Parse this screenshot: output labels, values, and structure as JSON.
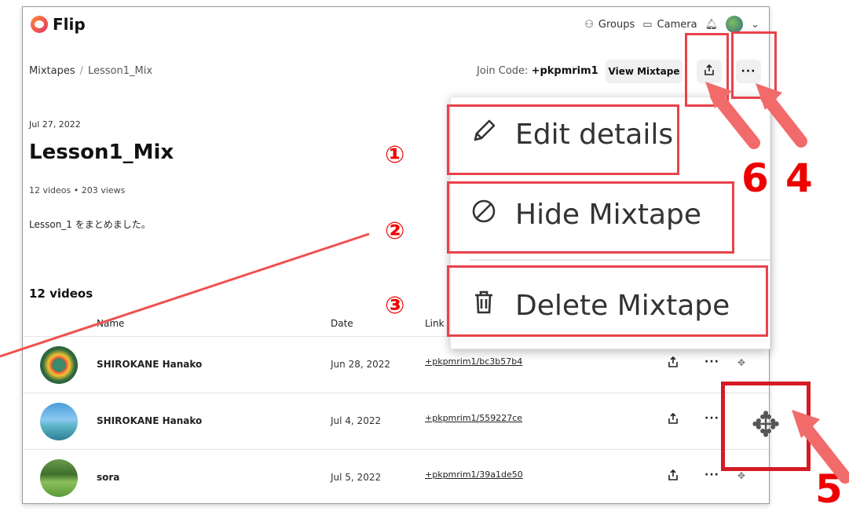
{
  "app": {
    "name": "Flip"
  },
  "header": {
    "groups": "Groups",
    "camera": "Camera",
    "groups_icon": "people-icon",
    "camera_icon": "camera-icon",
    "bell_icon": "bell-icon",
    "chevron_icon": "chevron-down-icon"
  },
  "breadcrumb": {
    "root": "Mixtapes",
    "sep": "/",
    "current": "Lesson1_Mix"
  },
  "join": {
    "label": "Join Code: ",
    "code": "+pkpmrim1"
  },
  "buttons": {
    "view_mixtape": "View Mixtape",
    "share_glyph": "⇧",
    "more_glyph": "···"
  },
  "mixtape": {
    "date": "Jul 27, 2022",
    "title": "Lesson1_Mix",
    "stats": "12 videos • 203 views",
    "description": "Lesson_1 をまとめました。",
    "video_count": "12 videos"
  },
  "table": {
    "headers": {
      "name": "Name",
      "date": "Date",
      "link": "Link"
    },
    "rows": [
      {
        "name": "SHIROKANE Hanako",
        "date": "Jun 28, 2022",
        "link": "+pkpmrim1/bc3b57b4",
        "thumb": "earth-thumbnail"
      },
      {
        "name": "SHIROKANE Hanako",
        "date": "Jul 4, 2022",
        "link": "+pkpmrim1/559227ce",
        "thumb": "sky-thumbnail"
      },
      {
        "name": "sora",
        "date": "Jul 5, 2022",
        "link": "+pkpmrim1/39a1de50",
        "thumb": "field-thumbnail"
      }
    ]
  },
  "menu": {
    "items": [
      {
        "label": "Edit details",
        "icon": "pencil-icon"
      },
      {
        "label": "Hide Mixtape",
        "icon": "hide-icon"
      },
      {
        "label": "Delete Mixtape",
        "icon": "trash-icon"
      }
    ]
  },
  "annotations": {
    "circled": [
      "①",
      "②",
      "③"
    ],
    "numbers": [
      "6",
      "4",
      "5"
    ]
  },
  "colors": {
    "annotation": "#e8424a",
    "annotation_dark": "#d41b25",
    "annotation_text": "#ee0000"
  }
}
